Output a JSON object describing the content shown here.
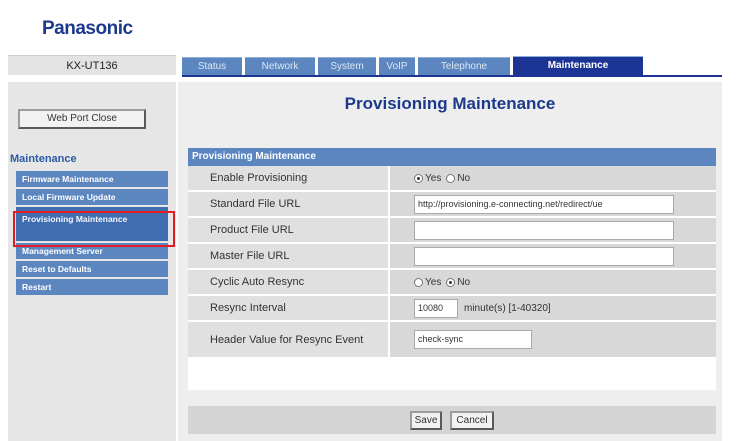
{
  "brand": {
    "logo": "Panasonic",
    "model": "KX-UT136"
  },
  "tabs": [
    {
      "label": "Status",
      "active": false,
      "width": 60
    },
    {
      "label": "Network",
      "active": false,
      "width": 70
    },
    {
      "label": "System",
      "active": false,
      "width": 58
    },
    {
      "label": "VoIP",
      "active": false,
      "width": 36
    },
    {
      "label": "Telephone",
      "active": false,
      "width": 92
    },
    {
      "label": "Maintenance",
      "active": true,
      "width": 130
    }
  ],
  "sidebar": {
    "web_port_button": "Web Port Close",
    "heading": "Maintenance",
    "items": [
      {
        "label": "Firmware Maintenance",
        "selected": false
      },
      {
        "label": "Local Firmware Update",
        "selected": false
      },
      {
        "label": "Provisioning Maintenance",
        "selected": true
      },
      {
        "label": "Management Server",
        "selected": false
      },
      {
        "label": "Reset to Defaults",
        "selected": false
      },
      {
        "label": "Restart",
        "selected": false
      }
    ]
  },
  "main": {
    "page_title": "Provisioning Maintenance",
    "panel_title": "Provisioning Maintenance",
    "rows": [
      {
        "label": "Enable Provisioning",
        "type": "radio",
        "options": [
          "Yes",
          "No"
        ],
        "selected": "Yes"
      },
      {
        "label": "Standard File URL",
        "type": "text",
        "value": "http://provisioning.e-connecting.net/redirect/ue"
      },
      {
        "label": "Product File URL",
        "type": "text",
        "value": ""
      },
      {
        "label": "Master File URL",
        "type": "text",
        "value": ""
      },
      {
        "label": "Cyclic Auto Resync",
        "type": "radio",
        "options": [
          "Yes",
          "No"
        ],
        "selected": "No"
      },
      {
        "label": "Resync Interval",
        "type": "number",
        "value": "10080",
        "unit": "minute(s) [1-40320]"
      },
      {
        "label": "Header Value for Resync Event",
        "type": "text-short",
        "value": "check-sync"
      }
    ],
    "save_label": "Save",
    "cancel_label": "Cancel"
  },
  "colors": {
    "brand_blue": "#1c3a8c",
    "tab_blue": "#5b86c0",
    "tab_active": "#1c3594",
    "highlight_red": "#e51b24"
  }
}
